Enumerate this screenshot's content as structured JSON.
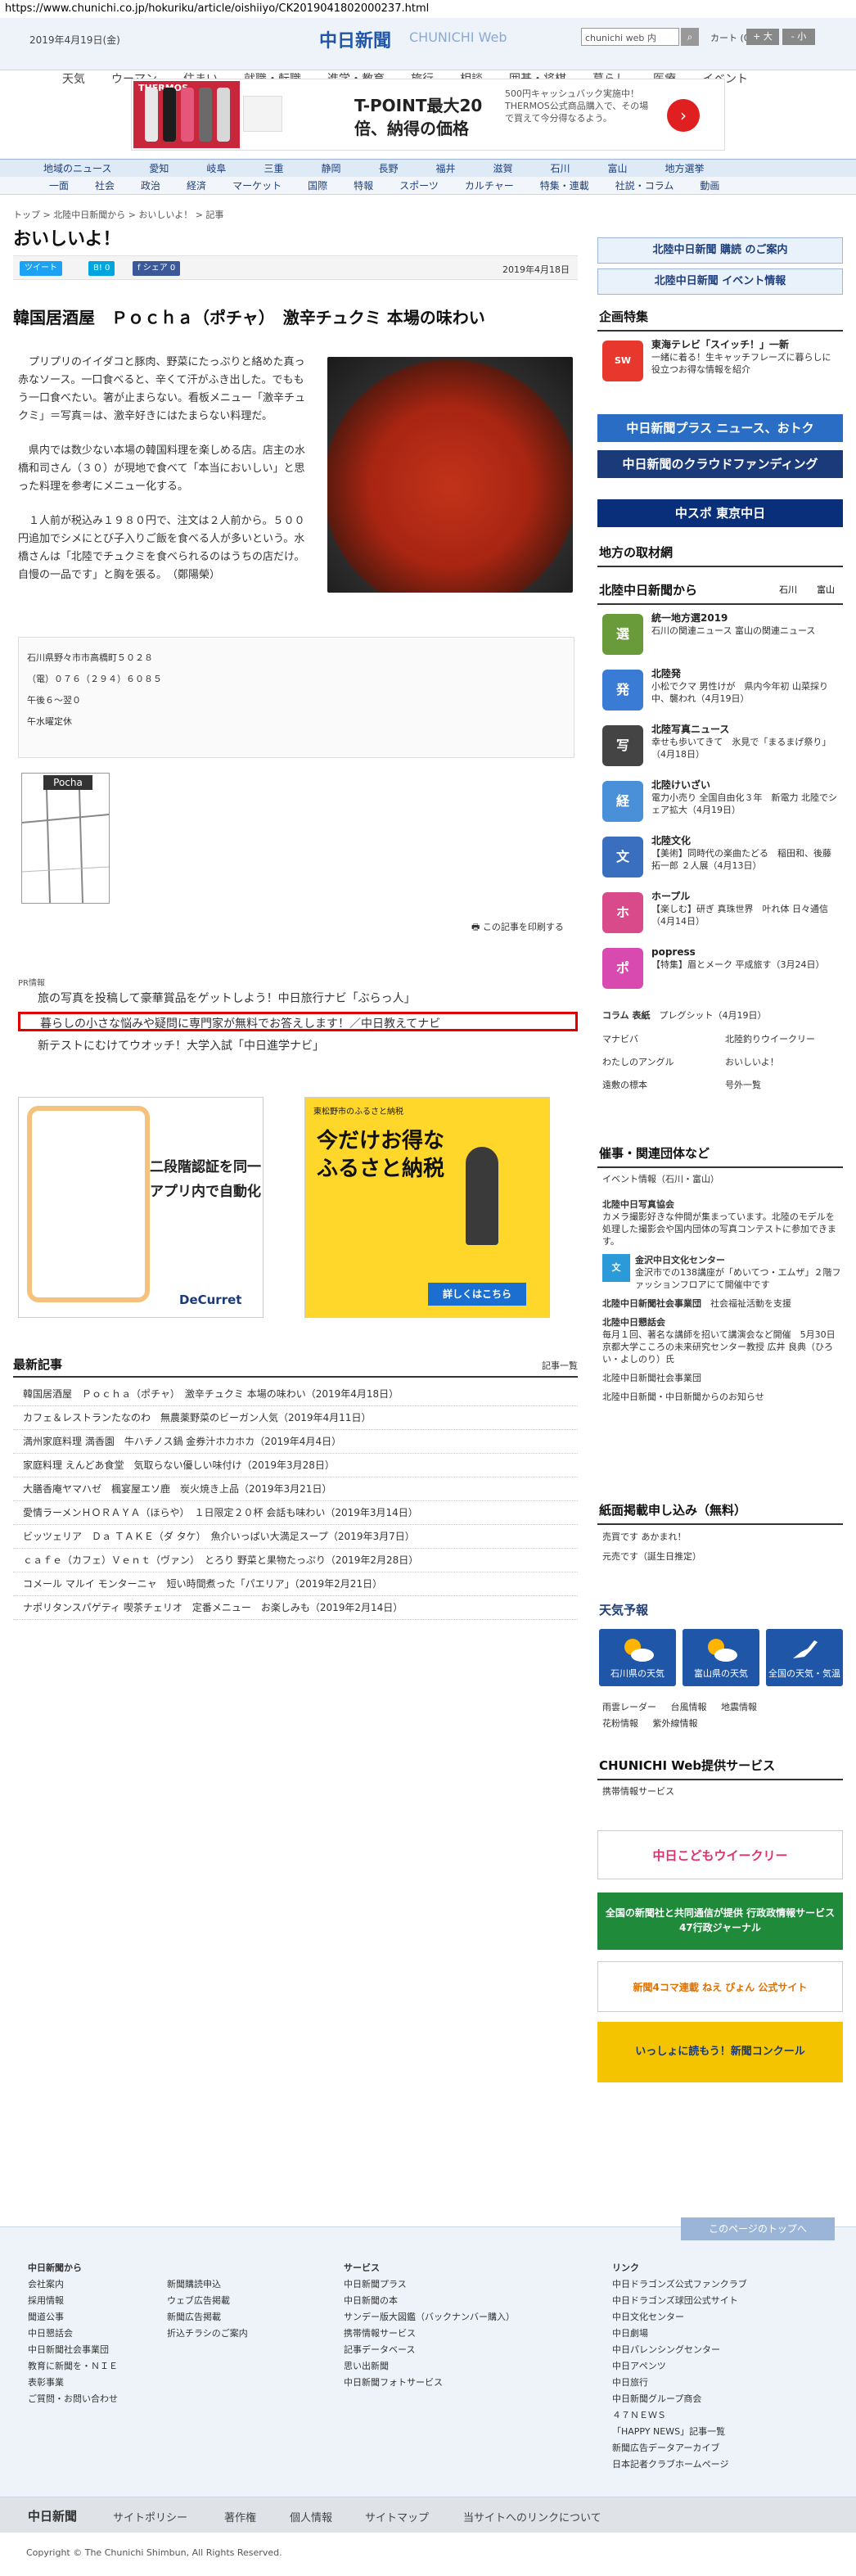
{
  "browser": {
    "url": "https://www.chunichi.co.jp/hokuriku/article/oishiiyo/CK2019041802000237.html"
  },
  "header": {
    "date": "2019年4月19日(金)",
    "logo": "中日新聞",
    "logo_web": "CHUNICHI Web",
    "search_placeholder": "chunichi web 内",
    "cart": "カート (0)",
    "font_plus": "+ 大",
    "font_minus": "- 小",
    "nav": [
      "天気",
      "ウーマン",
      "住まい",
      "就職・転職",
      "進学・教育",
      "旅行",
      "相談",
      "囲碁・将棋",
      "暮らし",
      "医療",
      "イベント"
    ]
  },
  "ad": {
    "brand": "THERMOS",
    "line1": "T-POINT最大20",
    "line2": "倍、納得の価格",
    "side": "500円キャッシュバック実施中！THERMOS公式商品購入で、その場で買えて今分得なるよう。"
  },
  "region_nav": [
    "地域のニュース",
    "愛知",
    "岐阜",
    "三重",
    "静岡",
    "長野",
    "福井",
    "滋賀",
    "石川",
    "富山",
    "地方選挙"
  ],
  "cat_nav": [
    "一面",
    "社会",
    "政治",
    "経済",
    "マーケット",
    "国際",
    "特報",
    "スポーツ",
    "カルチャー",
    "特集・連載",
    "社説・コラム",
    "動画"
  ],
  "breadcrumb": "トップ > 北陸中日新聞から > おいしいよ！ > 記事",
  "page_title": "おいしいよ！",
  "share": {
    "tweet": "ツイート",
    "hatena": "B! 0",
    "fb": "f シェア 0"
  },
  "article": {
    "date": "2019年4月18日",
    "headline": "韓国居酒屋　Ｐｏｃｈａ（ポチャ）　激辛チュクミ 本場の味わい",
    "paragraphs": [
      "プリプリのイイダコと豚肉、野菜にたっぷりと絡めた真っ赤なソース。一口食べると、辛くて汗がふき出した。でももう一口食べたい。箸が止まらない。看板メニュー「激辛チュクミ」＝写真＝は、激辛好きにはたまらない料理だ。",
      "県内では数少ない本場の韓国料理を楽しめる店。店主の水橋和司さん（３０）が現地で食べて「本当においしい」と思った料理を参考にメニュー化する。",
      "１人前が税込み１９８０円で、注文は２人前から。５００円追加でシメにとび子入りご飯を食べる人が多いという。水橋さんは「北陸でチュクミを食べられるのはうちの店だけ。自慢の一品です」と胸を張る。　（鄭陽榮）"
    ],
    "shop_info": [
      "石川県野々市市高橋町５０２８",
      "（電）０７６（２９４）６０８５",
      "午後６～翌０",
      "午水曜定休"
    ],
    "map_pin": "Pocha",
    "print": "この記事を印刷する"
  },
  "pr": {
    "label": "PR情報",
    "items": [
      "旅の写真を投稿して豪華賞品をゲットしよう！中日旅行ナビ「ぶらっ人」",
      "暮らしの小さな悩みや疑問に専門家が無料でお答えします！／中日教えてナビ",
      "新テストにむけてウオッチ！大学入試「中日進学ナビ」"
    ]
  },
  "ads_bottom": {
    "left_line1": "二段階認証を同一",
    "left_line2": "アプリ内で自動化",
    "left_brand": "DeCurret",
    "right_top": "東松野市のふるさと納税",
    "right_main": "今だけお得な ふるさと納税",
    "right_btn": "詳しくはこちら"
  },
  "latest": {
    "title": "最新記事",
    "more": "記事一覧",
    "items": [
      "韓国居酒屋　Ｐｏｃｈａ（ポチャ）　激辛チュクミ 本場の味わい（2019年4月18日）",
      "カフェ＆レストランたなのわ　無農薬野菜のビーガン人気（2019年4月11日）",
      "満州家庭料理 満香園　牛ハチノス鍋 金券汁ホカホカ（2019年4月4日）",
      "家庭料理 えんどあ食堂　気取らない優しい味付け（2019年3月28日）",
      "大膳香庵ヤマハゼ　楓宴屋エソ鹿　炭火焼き上品（2019年3月21日）",
      "愛情ラーメンＨＯＲＡＹＡ（ほらや）　１日限定２０杯 会話も味わい（2019年3月14日）",
      "ビッツェリア　Ｄａ ＴＡＫＥ（ダ タケ）　魚介いっぱい大満足スープ（2019年3月7日）",
      "ｃａｆｅ（カフェ）Ｖｅｎｔ（ヴァン）　とろり 野菜と果物たっぷり（2019年2月28日）",
      "コメール マルイ モンターニャ　短い時間煮った「パエリア」（2019年2月21日）",
      "ナポリタンスパゲティ 喫茶チェリオ　定番メニュー　お楽しみも（2019年2月14日）"
    ]
  },
  "sidebar": {
    "subscribe": "北陸中日新聞 購読 のご案内",
    "event": "北陸中日新聞 イベント情報",
    "kikaku_title": "企画特集",
    "kikaku_item_title": "東海テレビ「スイッチ！」一新",
    "kikaku_item_text": "一緒に着る！生キャッチフレーズに暮らしに役立つお得な情報を紹介",
    "banner1": "中日新聞プラス ニュース、おトク",
    "banner2": "中日新聞のクラウドファンディング",
    "banner3": "中スポ 東京中日",
    "tori_title": "地方の取材網",
    "hokuriku_title": "北陸中日新聞から",
    "hokuriku_links": [
      "石川",
      "富山"
    ],
    "hokuriku_items": [
      {
        "title": "統一地方選2019",
        "text": "石川の関連ニュース\n富山の関連ニュース",
        "icon": "選",
        "color": "#6a9b3a"
      },
      {
        "title": "北陸発",
        "text": "小松でクマ 男性けが　県内今年初 山菜採り中、襲われ（4月19日）",
        "icon": "発",
        "color": "#3a7bd5"
      },
      {
        "title": "北陸写真ニュース",
        "text": "幸せも歩いてきて　氷見で「まるまげ祭り」（4月18日）",
        "icon": "写",
        "color": "#444444"
      },
      {
        "title": "北陸けいざい",
        "text": "電力小売り 全国自由化３年　新電力 北陸でシェア拡大（4月19日）",
        "icon": "経",
        "color": "#4a90d9"
      },
      {
        "title": "北陸文化",
        "text": "【美術】同時代の楽曲たどる　稲田和、後藤拓一郎 ２人展（4月13日）",
        "icon": "文",
        "color": "#3a6fc0"
      },
      {
        "title": "ホープル",
        "text": "【楽しむ】研ぎ 真珠世界　叶れ体 日々通信（4月14日）",
        "icon": "ホ",
        "color": "#d94a8a"
      },
      {
        "title": "popress",
        "text": "【特集】眉とメーク 平成旅す（3月24日）",
        "icon": "ポ",
        "color": "#d94ab0"
      }
    ],
    "column_label": "コラム 表紙",
    "column_text": "プレグシット（4月19日）",
    "grid_links": [
      "マナビバ",
      "北陸釣りウイークリー",
      "わたしのアングル",
      "おいしいよ！",
      "遠敷の標本",
      "号外一覧"
    ],
    "saiji_title": "催事・関連団体など",
    "saiji_sub": "イベント情報（石川・富山）",
    "saiji_items": [
      {
        "title": "北陸中日写真協会",
        "text": "カメラ撮影好きな仲間が集まっています。北陸のモデルを処理した撮影会や国内団体の写真コンテストに参加できます。"
      },
      {
        "title": "金沢中日文化センター",
        "text": "金沢市での138講座が「めいてつ・エムザ」２階ファッションフロアにて開催中です"
      },
      {
        "title": "北陸中日新聞社会事業団",
        "text": "社会福祉活動を支援"
      },
      {
        "title": "北陸中日懇話会",
        "text": "毎月１回、著名な講師を招いて講演会など開催　5月30日 京都大学こころの未来研究センター教授 広井 良典（ひろい・よしのり）氏"
      },
      {
        "title": "北陸中日新聞社会事業団",
        "text": ""
      },
      {
        "title": "北陸中日新聞・中日新聞からのお知らせ",
        "text": ""
      }
    ],
    "kousai_title": "紙面掲載申し込み（無料）",
    "kousai_items": [
      "売買です あかまれ！",
      "元売です（誕生日推定）"
    ],
    "weather_title": "天気予報",
    "weather": [
      "石川県の天気",
      "富山県の天気",
      "全国の天気・気温"
    ],
    "weather_links": [
      "雨雲レーダー",
      "台風情報",
      "地震情報",
      "花粉情報",
      "紫外線情報"
    ],
    "service_title": "CHUNICHI Web提供サービス",
    "service_link": "携帯情報サービス",
    "banners_bottom": [
      "中日こどもウイークリー",
      "全国の新聞社と共同通信が提供 行政政情報サービス 47行政ジャーナル",
      "新聞4コマ連載 ねえ ぴょん 公式サイト",
      "いっしょに読もう！新聞コンクール"
    ]
  },
  "footer": {
    "back_top": "このページのトップへ",
    "col1_title": "中日新聞から",
    "col1": [
      "会社案内",
      "採用情報",
      "聞道公事",
      "中日懇話会",
      "中日新聞社会事業団",
      "教育に新聞を・ＮＩＥ",
      "表彰事業",
      "ご質問・お問い合わせ"
    ],
    "col2": [
      "新聞購読申込",
      "ウェブ広告掲載",
      "新聞広告掲載",
      "折込チラシのご案内"
    ],
    "col3_title": "サービス",
    "col3": [
      "中日新聞プラス",
      "中日新聞の本",
      "サンデー版大図鑑（バックナンバー購入）",
      "携帯情報サービス",
      "記事データベース",
      "思い出新聞",
      "中日新聞フォトサービス"
    ],
    "col4_title": "リンク",
    "col4": [
      "中日ドラゴンズ公式ファンクラブ",
      "中日ドラゴンズ球団公式サイト",
      "中日文化センター",
      "中日劇場",
      "中日パレンシングセンター",
      "中日アペンツ",
      "中日旅行",
      "中日新聞グループ商会",
      "４７ＮＥＷＳ",
      "「HAPPY NEWS」記事一覧",
      "新聞広告データアーカイブ",
      "日本記者クラブホームページ"
    ],
    "bottom_logo": "中日新聞",
    "bottom_links": [
      "サイトポリシー",
      "著作権",
      "個人情報",
      "サイトマップ",
      "当サイトへのリンクについて"
    ],
    "copyright": "Copyright © The Chunichi Shimbun, All Rights Reserved."
  }
}
